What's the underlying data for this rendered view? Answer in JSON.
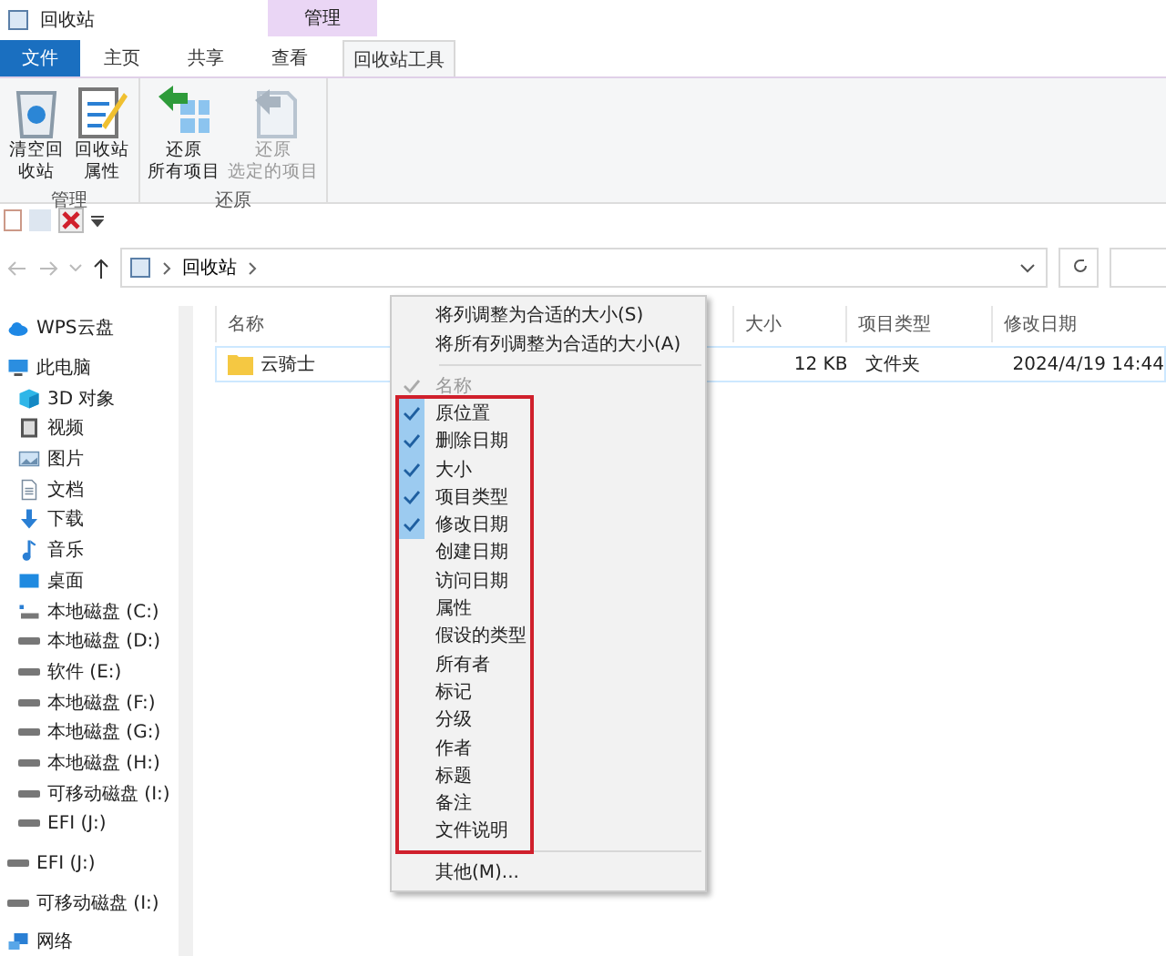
{
  "window": {
    "title": "回收站"
  },
  "context_tab": {
    "label": "管理"
  },
  "tabs": [
    {
      "label": "文件",
      "kind": "file",
      "selected": false
    },
    {
      "label": "主页",
      "kind": "plain",
      "selected": false
    },
    {
      "label": "共享",
      "kind": "plain",
      "selected": false
    },
    {
      "label": "查看",
      "kind": "plain",
      "selected": false
    },
    {
      "label": "回收站工具",
      "kind": "context",
      "selected": true
    }
  ],
  "ribbon_groups": [
    {
      "label": "管理",
      "buttons": [
        {
          "lines": [
            "清空回",
            "收站"
          ],
          "kind": "bin",
          "disabled": false
        },
        {
          "lines": [
            "回收站",
            "属性"
          ],
          "kind": "props",
          "disabled": false
        }
      ]
    },
    {
      "label": "还原",
      "buttons": [
        {
          "lines": [
            "还原",
            "所有项目"
          ],
          "kind": "restore_all",
          "disabled": false
        },
        {
          "lines": [
            "还原",
            "选定的项目"
          ],
          "kind": "restore_sel",
          "disabled": true
        }
      ]
    }
  ],
  "address": {
    "path": "回收站"
  },
  "sidebar": {
    "items": [
      {
        "label": "WPS云盘",
        "kind": "cloud"
      },
      {
        "label": "此电脑",
        "kind": "pc",
        "children": [
          {
            "label": "3D 对象",
            "kind": "cube"
          },
          {
            "label": "视频",
            "kind": "video"
          },
          {
            "label": "图片",
            "kind": "pictures"
          },
          {
            "label": "文档",
            "kind": "doc"
          },
          {
            "label": "下载",
            "kind": "download"
          },
          {
            "label": "音乐",
            "kind": "music"
          },
          {
            "label": "桌面",
            "kind": "desktop"
          },
          {
            "label": "本地磁盘 (C:)",
            "kind": "sysdrive"
          },
          {
            "label": "本地磁盘 (D:)",
            "kind": "drive"
          },
          {
            "label": "软件 (E:)",
            "kind": "drive"
          },
          {
            "label": "本地磁盘 (F:)",
            "kind": "drive"
          },
          {
            "label": "本地磁盘 (G:)",
            "kind": "drive"
          },
          {
            "label": "本地磁盘 (H:)",
            "kind": "drive"
          },
          {
            "label": "可移动磁盘 (I:)",
            "kind": "drive"
          },
          {
            "label": "EFI (J:)",
            "kind": "drive"
          }
        ]
      },
      {
        "label": "EFI (J:)",
        "kind": "drive"
      },
      {
        "label": "可移动磁盘 (I:)",
        "kind": "drive"
      },
      {
        "label": "网络",
        "kind": "network"
      }
    ]
  },
  "table": {
    "columns": [
      {
        "label": "名称",
        "kind": "name"
      },
      {
        "label": "大小",
        "kind": "size"
      },
      {
        "label": "项目类型",
        "kind": "type"
      },
      {
        "label": "修改日期",
        "kind": "date"
      }
    ],
    "rows": [
      {
        "name": "云骑士",
        "size": "12 KB",
        "type": "文件夹",
        "date": "2024/4/19 14:44"
      }
    ]
  },
  "context_menu": {
    "commands": [
      {
        "label": "将列调整为合适的大小(S)"
      },
      {
        "label": "将所有列调整为合适的大小(A)"
      }
    ],
    "columns": [
      {
        "label": "名称",
        "checked": true,
        "disabled": true
      },
      {
        "label": "原位置",
        "checked": true,
        "disabled": false
      },
      {
        "label": "删除日期",
        "checked": true,
        "disabled": false
      },
      {
        "label": "大小",
        "checked": true,
        "disabled": false
      },
      {
        "label": "项目类型",
        "checked": true,
        "disabled": false
      },
      {
        "label": "修改日期",
        "checked": true,
        "disabled": false
      },
      {
        "label": "创建日期",
        "checked": false,
        "disabled": false
      },
      {
        "label": "访问日期",
        "checked": false,
        "disabled": false
      },
      {
        "label": "属性",
        "checked": false,
        "disabled": false
      },
      {
        "label": "假设的类型",
        "checked": false,
        "disabled": false
      },
      {
        "label": "所有者",
        "checked": false,
        "disabled": false
      },
      {
        "label": "标记",
        "checked": false,
        "disabled": false
      },
      {
        "label": "分级",
        "checked": false,
        "disabled": false
      },
      {
        "label": "作者",
        "checked": false,
        "disabled": false
      },
      {
        "label": "标题",
        "checked": false,
        "disabled": false
      },
      {
        "label": "备注",
        "checked": false,
        "disabled": false
      },
      {
        "label": "文件说明",
        "checked": false,
        "disabled": false
      }
    ],
    "more": {
      "label": "其他(M)..."
    }
  }
}
